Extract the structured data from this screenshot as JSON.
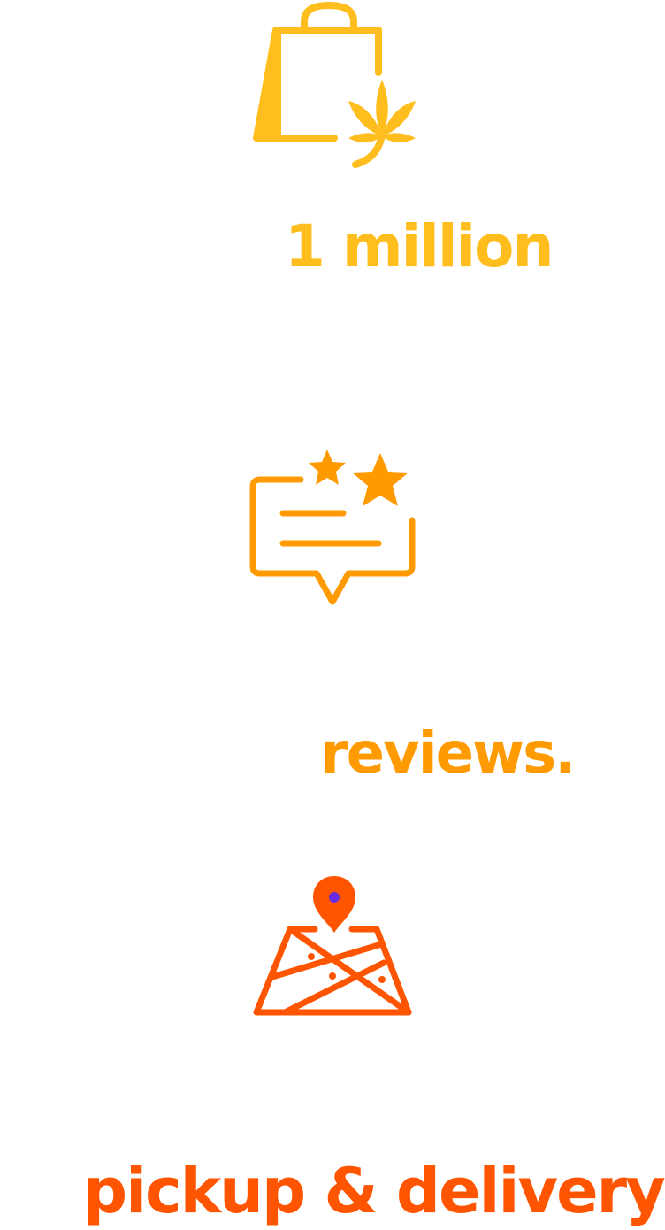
{
  "colors": {
    "shop": "#FFBE1E",
    "reviews": "#FF9A00",
    "delivery": "#FF5500",
    "pin_dot": "#6A2BE0"
  },
  "features": [
    {
      "icon": "shopping-bag-cannabis-leaf-icon",
      "headline": "1 million"
    },
    {
      "icon": "review-stars-chat-bubble-icon",
      "headline": "reviews."
    },
    {
      "icon": "map-location-pin-icon",
      "headline": "pickup & delivery"
    }
  ]
}
